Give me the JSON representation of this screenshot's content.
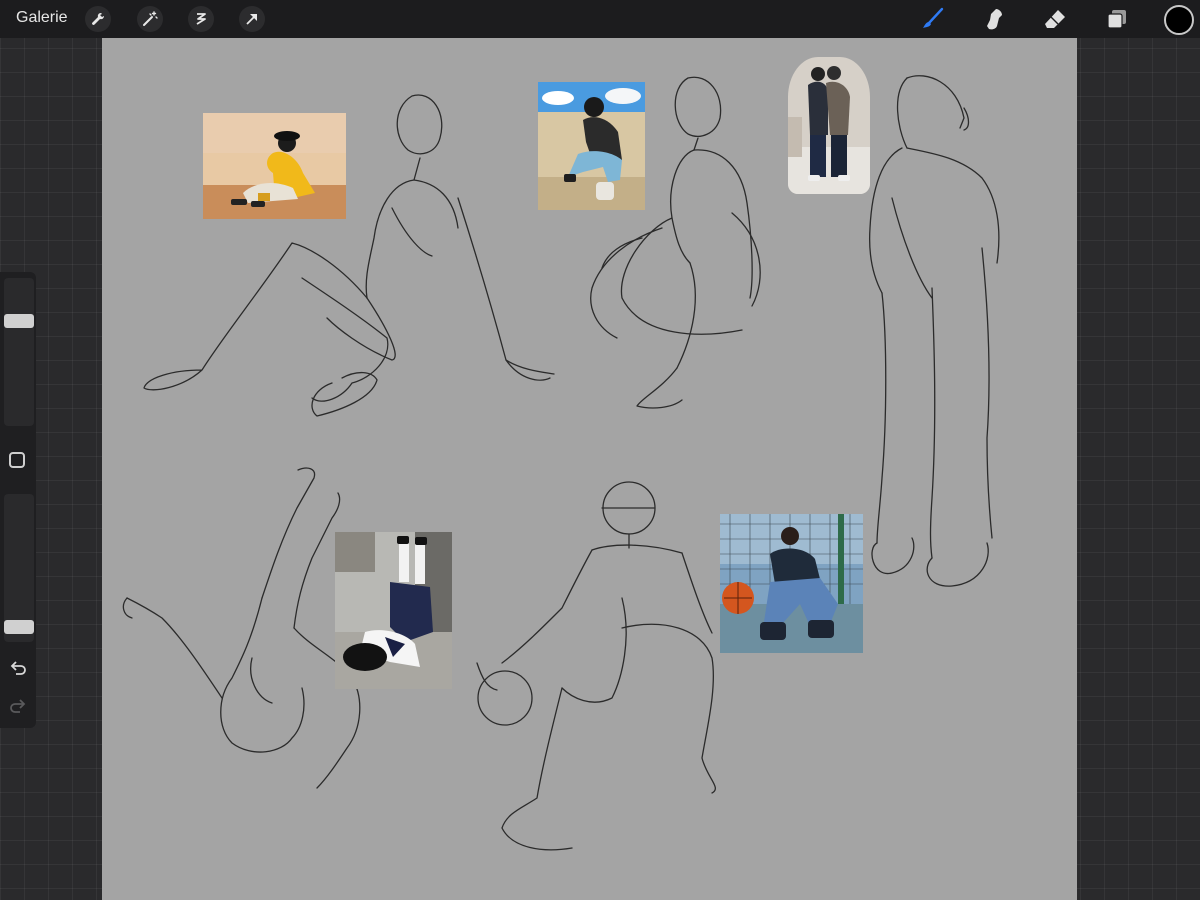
{
  "topbar": {
    "gallery_label": "Galerie",
    "left_tools": [
      "wrench-icon",
      "magic-wand-icon",
      "selection-icon",
      "transform-arrow-icon"
    ],
    "right_tools": [
      "brush-icon",
      "smudge-icon",
      "eraser-icon",
      "layers-icon"
    ],
    "active_tool": "brush-icon",
    "active_color": "#2f7bf5",
    "current_color": "#000000"
  },
  "sidebar": {
    "size_slider_value": 0.73,
    "opacity_slider_value": 0.06,
    "icons": [
      "modifier-square-icon",
      "undo-icon",
      "redo-icon"
    ]
  },
  "canvas": {
    "background": "#a4a4a4",
    "reference_photos": [
      "photo-girl-yellow-hoodie-bucket-hat",
      "photo-girl-crouching-jeans",
      "photo-two-people-standing",
      "photo-girl-lying-school-uniform",
      "photo-girl-basketball-court"
    ]
  }
}
